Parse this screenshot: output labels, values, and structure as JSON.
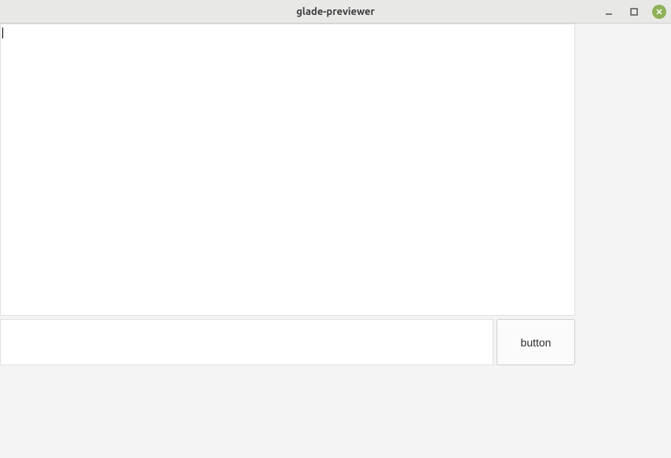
{
  "window": {
    "title": "glade-previewer"
  },
  "main": {
    "button_label": "button"
  }
}
